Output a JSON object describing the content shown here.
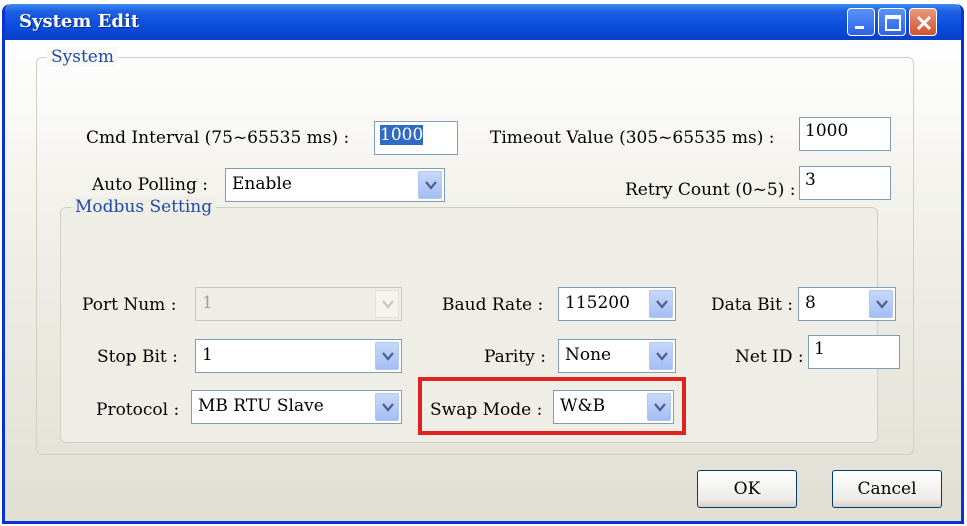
{
  "window": {
    "title": "System Edit"
  },
  "system": {
    "legend": "System",
    "cmd_interval_label": "Cmd Interval (75~65535 ms) :",
    "cmd_interval_value": "1000",
    "timeout_label": "Timeout Value (305~65535 ms) :",
    "timeout_value": "1000",
    "auto_polling_label": "Auto Polling :",
    "auto_polling_value": "Enable",
    "retry_label": "Retry Count (0~5) :",
    "retry_value": "3"
  },
  "modbus": {
    "legend": "Modbus Setting",
    "port_label": "Port Num :",
    "port_value": "1",
    "baud_label": "Baud Rate :",
    "baud_value": "115200",
    "databit_label": "Data Bit :",
    "databit_value": "8",
    "stopbit_label": "Stop Bit :",
    "stopbit_value": "1",
    "parity_label": "Parity :",
    "parity_value": "None",
    "netid_label": "Net ID :",
    "netid_value": "1",
    "protocol_label": "Protocol :",
    "protocol_value": "MB RTU Slave",
    "swap_label": "Swap Mode :",
    "swap_value": "W&B"
  },
  "buttons": {
    "ok": "OK",
    "cancel": "Cancel"
  },
  "icons": [
    "minimize-icon",
    "maximize-icon",
    "close-icon",
    "chevron-down-icon"
  ],
  "colors": {
    "titlebar": "#0a4ede",
    "highlight": "#e0221f",
    "legend": "#1e4aa8"
  }
}
